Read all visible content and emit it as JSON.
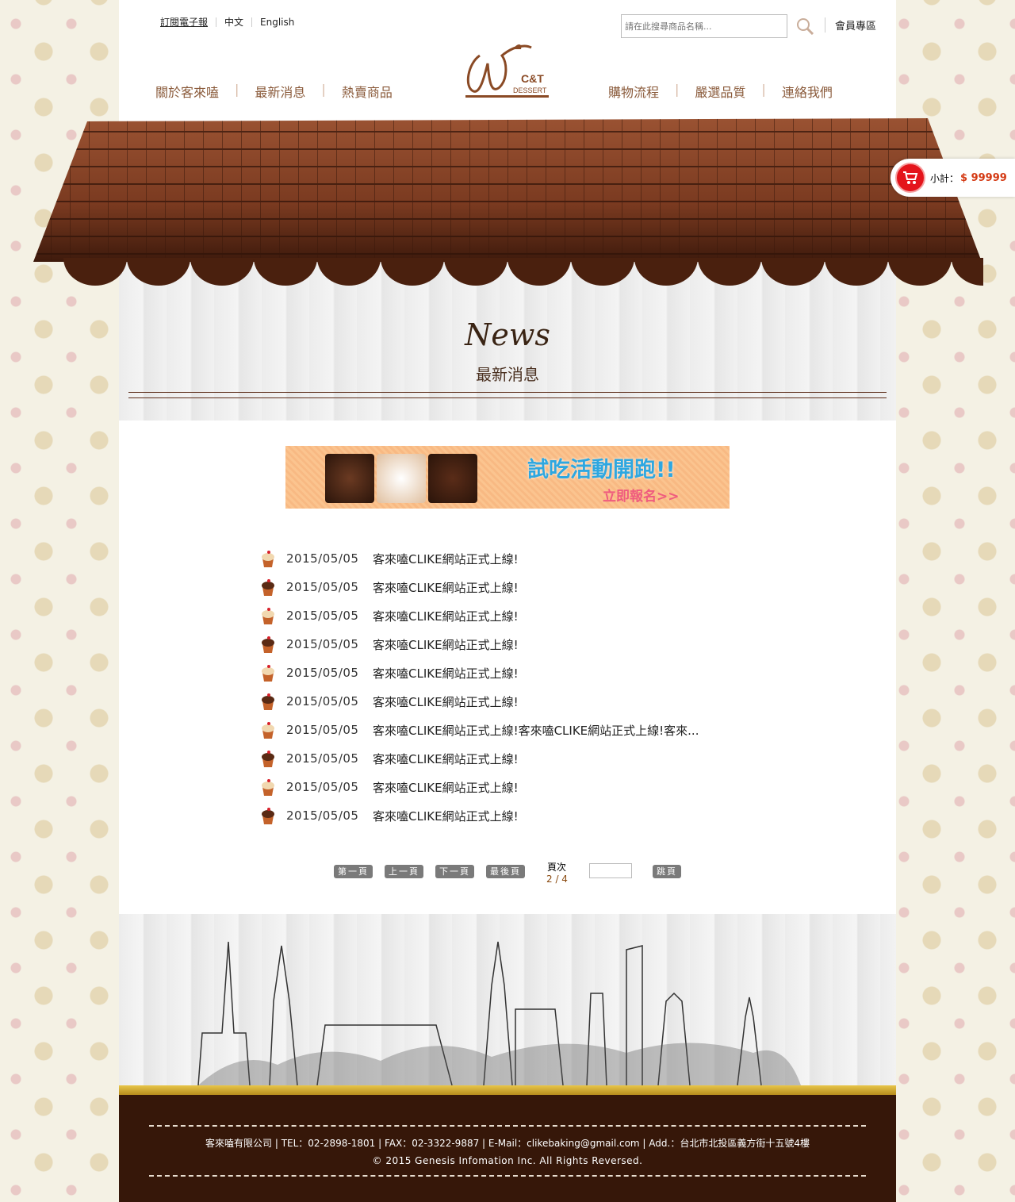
{
  "header": {
    "links": [
      "訂閱電子報",
      "中文",
      "English"
    ],
    "search_placeholder": "請在此搜尋商品名稱...",
    "member": "會員專區",
    "nav_left": [
      "關於客來嗑",
      "最新消息",
      "熱賣商品"
    ],
    "nav_right": [
      "購物流程",
      "嚴選品質",
      "連絡我們"
    ],
    "logo": "C&T DESSERT"
  },
  "cart": {
    "label": "小計：",
    "amount": "$ 99999"
  },
  "section": {
    "title": "News",
    "subtitle": "最新消息"
  },
  "banner": {
    "title": "試吃活動開跑!!",
    "cta": "立即報名>>"
  },
  "news": [
    {
      "date": "2015/05/05",
      "title": "客來嗑CLIKE網站正式上線!"
    },
    {
      "date": "2015/05/05",
      "title": "客來嗑CLIKE網站正式上線!"
    },
    {
      "date": "2015/05/05",
      "title": "客來嗑CLIKE網站正式上線!"
    },
    {
      "date": "2015/05/05",
      "title": "客來嗑CLIKE網站正式上線!"
    },
    {
      "date": "2015/05/05",
      "title": "客來嗑CLIKE網站正式上線!"
    },
    {
      "date": "2015/05/05",
      "title": "客來嗑CLIKE網站正式上線!"
    },
    {
      "date": "2015/05/05",
      "title": "客來嗑CLIKE網站正式上線!客來嗑CLIKE網站正式上線!客來..."
    },
    {
      "date": "2015/05/05",
      "title": "客來嗑CLIKE網站正式上線!"
    },
    {
      "date": "2015/05/05",
      "title": "客來嗑CLIKE網站正式上線!"
    },
    {
      "date": "2015/05/05",
      "title": "客來嗑CLIKE網站正式上線!"
    }
  ],
  "pager": {
    "first": "第一頁",
    "prev": "上一頁",
    "next": "下一頁",
    "last": "最後頁",
    "page_label": "頁次",
    "page_info": "2 / 4",
    "jump": "跳頁",
    "jump_value": ""
  },
  "footer": {
    "info": "客來嗑有限公司 | TEL：02-2898-1801 | FAX：02-3322-9887 | E-Mail：clikebaking@gmail.com | Add.：台北市北投區義方街十五號4樓",
    "copyright": "© 2015 Genesis Infomation Inc. All Rights Reversed."
  }
}
